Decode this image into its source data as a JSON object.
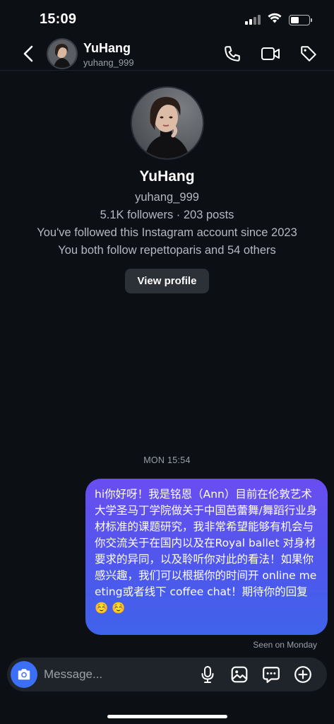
{
  "status_bar": {
    "time": "15:09",
    "battery_level": 0.45
  },
  "header": {
    "name": "YuHang",
    "handle": "yuhang_999",
    "icons": [
      "back-chevron-icon",
      "phone-icon",
      "video-camera-icon",
      "tag-icon"
    ]
  },
  "profile": {
    "name": "YuHang",
    "handle": "yuhang_999",
    "stats": "5.1K followers · 203 posts",
    "follow_since": "You've followed this Instagram account since 2023",
    "mutuals": "You both follow repettoparis and 54 others",
    "view_profile_label": "View profile"
  },
  "chat": {
    "timestamp": "MON 15:54",
    "message": "hi你好呀！我是铭恩（Ann）目前在伦敦艺术大学圣马丁学院做关于中国芭蕾舞/舞蹈行业身材标准的课题研究，我非常希望能够有机会与你交流关于在国内以及在Royal ballet 对身材要求的异同，以及聆听你对此的看法！如果你感兴趣，我们可以根据你的时间开 online meeting或者线下 coffee chat！期待你的回复☺️ ☺️",
    "seen": "Seen on Monday"
  },
  "composer": {
    "placeholder": "Message...",
    "icons": [
      "camera-icon",
      "microphone-icon",
      "gallery-icon",
      "sticker-icon",
      "plus-icon"
    ]
  },
  "colors": {
    "background": "#0c0f14",
    "bubble_top": "#6a4df0",
    "bubble_bottom": "#3f63ea",
    "camera_button": "#3b6ff6"
  }
}
